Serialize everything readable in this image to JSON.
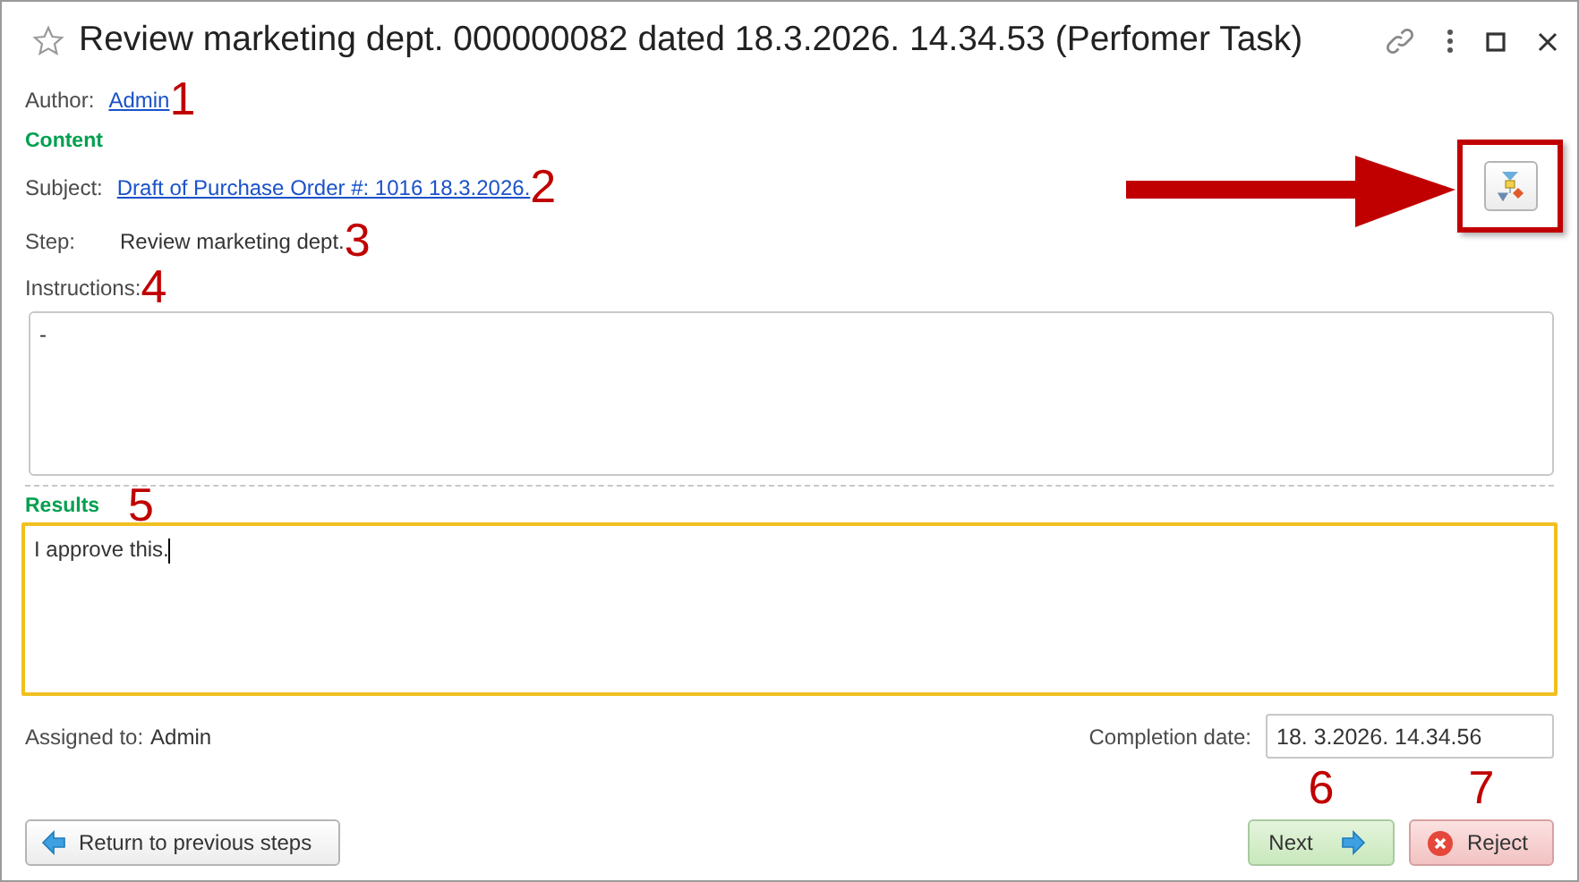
{
  "window": {
    "title": "Review marketing dept. 000000082 dated 18.3.2026. 14.34.53 (Perfomer Task)"
  },
  "author": {
    "label": "Author:",
    "value": "Admin",
    "annotation": "1"
  },
  "content_section": {
    "title": "Content"
  },
  "subject": {
    "label": "Subject:",
    "value": "Draft of Purchase Order #: 1016 18.3.2026.",
    "annotation": "2"
  },
  "step": {
    "label": "Step:",
    "value": "Review marketing dept.",
    "annotation": "3"
  },
  "instructions": {
    "label": "Instructions:",
    "value": "-",
    "annotation": "4"
  },
  "results": {
    "title": "Results",
    "value": "I approve this.",
    "annotation": "5"
  },
  "assigned": {
    "label": "Assigned to:",
    "value": "Admin"
  },
  "completion_date": {
    "label": "Completion date:",
    "value": "18. 3.2026. 14.34.56"
  },
  "buttons": [
    {
      "label": "Return to previous steps",
      "kind": "back"
    },
    {
      "label": "Next",
      "kind": "next",
      "annotation": "6"
    },
    {
      "label": "Reject",
      "kind": "reject",
      "annotation": "7"
    }
  ]
}
